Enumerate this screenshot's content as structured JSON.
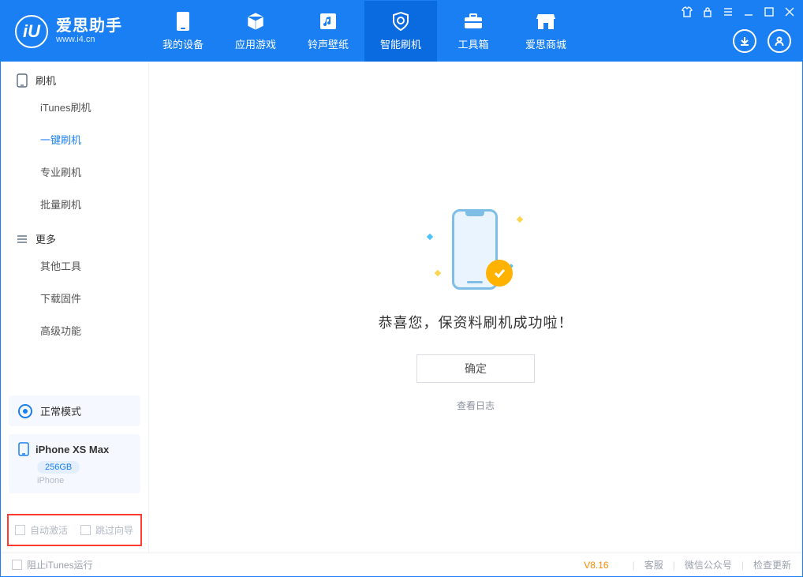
{
  "header": {
    "logo_title": "爱思助手",
    "logo_sub": "www.i4.cn",
    "tabs": [
      {
        "label": "我的设备",
        "icon": "device-icon"
      },
      {
        "label": "应用游戏",
        "icon": "cube-icon"
      },
      {
        "label": "铃声壁纸",
        "icon": "music-icon"
      },
      {
        "label": "智能刷机",
        "icon": "shield-icon"
      },
      {
        "label": "工具箱",
        "icon": "toolbox-icon"
      },
      {
        "label": "爱思商城",
        "icon": "shop-icon"
      }
    ]
  },
  "sidebar": {
    "group1_label": "刷机",
    "items1": [
      "iTunes刷机",
      "一键刷机",
      "专业刷机",
      "批量刷机"
    ],
    "active1_index": 1,
    "group2_label": "更多",
    "items2": [
      "其他工具",
      "下载固件",
      "高级功能"
    ],
    "mode_label": "正常模式",
    "device_name": "iPhone XS Max",
    "device_storage": "256GB",
    "device_type": "iPhone",
    "redbox": {
      "opt1": "自动激活",
      "opt2": "跳过向导"
    }
  },
  "main": {
    "success_text": "恭喜您，保资料刷机成功啦！",
    "ok_button": "确定",
    "log_link": "查看日志"
  },
  "footer": {
    "block_itunes": "阻止iTunes运行",
    "version": "V8.16",
    "links": [
      "客服",
      "微信公众号",
      "检查更新"
    ]
  }
}
